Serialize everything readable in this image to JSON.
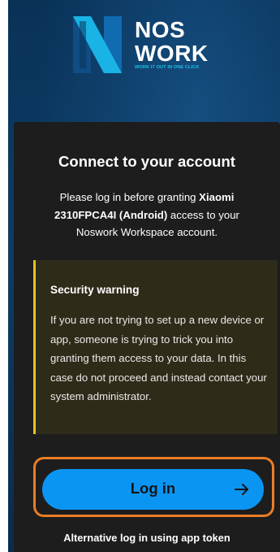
{
  "brand": {
    "name_line1": "NOS",
    "name_line2": "WORK",
    "tagline": "WORK IT OUT IN ONE CLICK",
    "logo_icon": "noswork-logo-icon",
    "accent_color": "#18c3ea"
  },
  "card": {
    "title": "Connect to your account",
    "description": {
      "before": "Please log in before granting ",
      "device": "Xiaomi 2310FPCA4I (Android)",
      "after": " access to your Noswork Workspace account."
    },
    "warning": {
      "title": "Security warning",
      "body": "If you are not trying to set up a new device or app, someone is trying to trick you into granting them access to your data. In this case do not proceed and instead contact your system administrator.",
      "accent_color": "#e6c01f"
    },
    "login_button": {
      "label": "Log in",
      "icon": "arrow-right-icon",
      "color": "#0b95f3"
    },
    "alternative_link": "Alternative log in using app token",
    "highlight_color": "#ea7e26"
  }
}
